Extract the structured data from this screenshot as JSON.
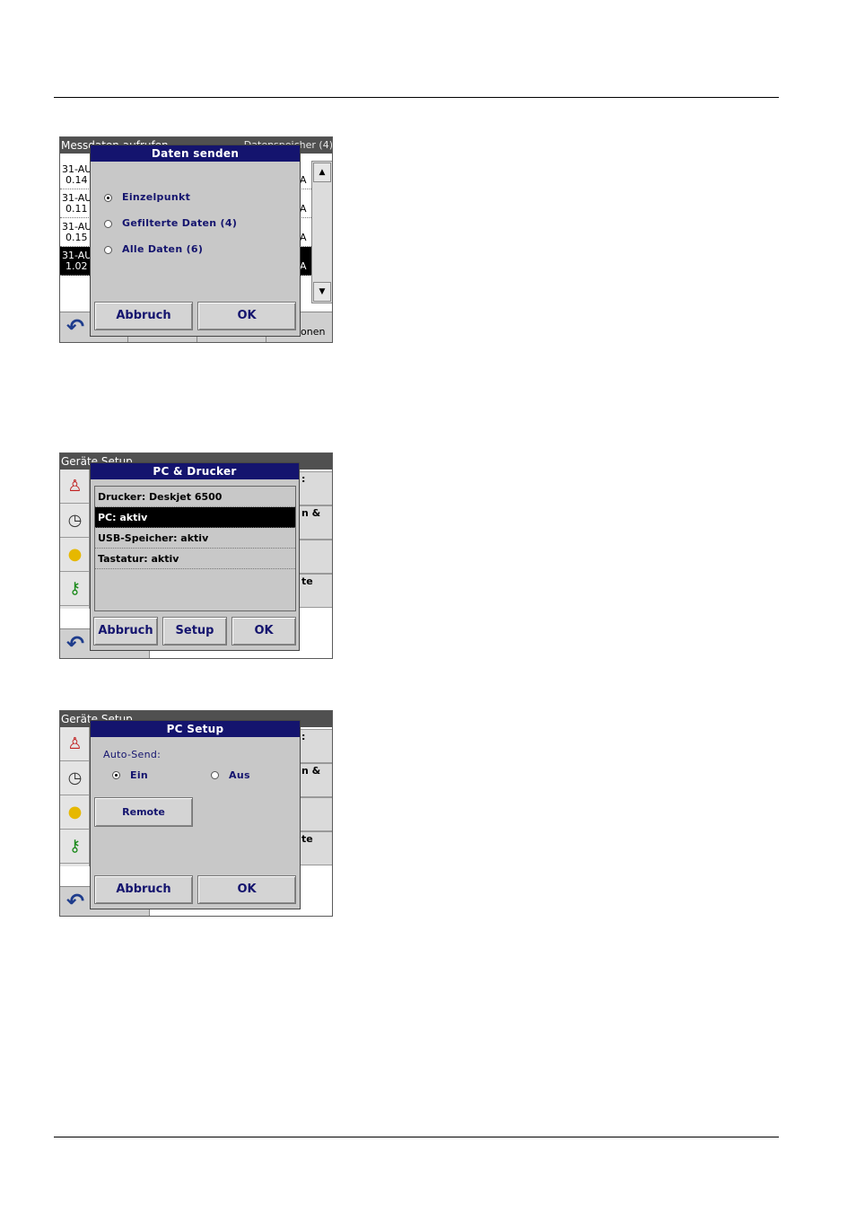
{
  "screen1": {
    "bg_header_title": "Messdaten aufrufen",
    "bg_header_right": "Datenspeicher (4)",
    "rows": [
      {
        "l1": "31-AU",
        "l2": "0.14",
        "a": "A"
      },
      {
        "l1": "31-AU",
        "l2": "0.11",
        "a": "A"
      },
      {
        "l1": "31-AU",
        "l2": "0.15",
        "a": "A"
      },
      {
        "l1": "31-AU",
        "l2": "1.02",
        "a": "A"
      }
    ],
    "bottom_partial": "onen",
    "dialog": {
      "title": "Daten senden",
      "options": [
        "Einzelpunkt",
        "Gefilterte Daten (4)",
        "Alle Daten (6)"
      ],
      "cancel": "Abbruch",
      "ok": "OK"
    }
  },
  "screen2": {
    "bg_header_title": "Geräte Setup",
    "right_partials": [
      ":",
      "n &",
      "",
      "te"
    ],
    "dialog": {
      "title": "PC & Drucker",
      "items": [
        "Drucker: Deskjet 6500",
        "PC: aktiv",
        "USB-Speicher: aktiv",
        "Tastatur: aktiv"
      ],
      "cancel": "Abbruch",
      "setup": "Setup",
      "ok": "OK"
    }
  },
  "screen3": {
    "bg_header_title": "Geräte Setup",
    "right_partials": [
      ":",
      "n &",
      "",
      "te"
    ],
    "dialog": {
      "title": "PC Setup",
      "autosend_label": "Auto-Send:",
      "on_label": "Ein",
      "off_label": "Aus",
      "remote": "Remote",
      "cancel": "Abbruch",
      "ok": "OK"
    }
  },
  "colors": {
    "dialog_title_bg": "#14146e",
    "dialog_bg": "#c8c8c8",
    "label_text": "#14146e"
  },
  "icons": [
    "back-arrow-icon",
    "user-icon",
    "clock-calendar-icon",
    "lamp-icon",
    "key-icon"
  ]
}
